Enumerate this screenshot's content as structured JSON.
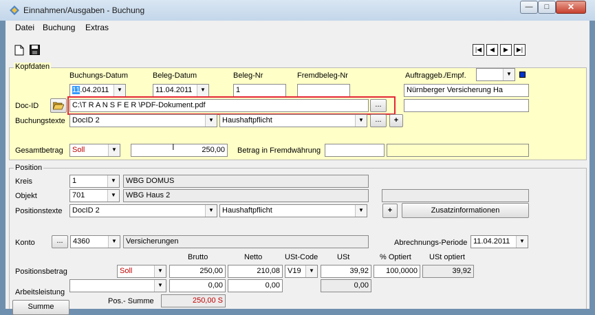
{
  "window": {
    "title": "Einnahmen/Ausgaben - Buchung",
    "close_glyph": "✕",
    "min_glyph": "—",
    "max_glyph": "□"
  },
  "menu": [
    "Datei",
    "Buchung",
    "Extras"
  ],
  "toolbar": {
    "icons": [
      "new-document-icon",
      "save-icon"
    ],
    "nav": [
      "|◀",
      "◀",
      "▶",
      "▶|"
    ]
  },
  "kopfdaten": {
    "legend": "Kopfdaten",
    "buchungsdatum": {
      "label": "Buchungs-Datum",
      "day": "11",
      "rest": ".04.2011"
    },
    "belegdatum": {
      "label": "Beleg-Datum",
      "value": "11.04.2011"
    },
    "belegnr": {
      "label": "Beleg-Nr",
      "value": "1"
    },
    "fremdbelegnr": {
      "label": "Fremdbeleg-Nr",
      "value": ""
    },
    "auftraggeber": {
      "label": "Auftraggeb./Empf.",
      "combo": "",
      "value": "Nürnberger Versicherung Ha",
      "extra": ""
    },
    "docid": {
      "label": "Doc-ID",
      "value": "C:\\T R A N S F E R \\PDF-Dokument.pdf",
      "browse": "..."
    },
    "buchungstexte": {
      "label": "Buchungstexte",
      "combo1": "DocID 2",
      "combo2": "Haushaftpflicht",
      "dots": "...",
      "plus": "+"
    },
    "gesamtbetrag": {
      "label": "Gesamtbetrag",
      "soll": "Soll",
      "value": "250,00"
    },
    "fremdwaehrung": {
      "label": "Betrag in Fremdwährung",
      "value": "",
      "extra": ""
    }
  },
  "position": {
    "legend": "Position",
    "kreis": {
      "label": "Kreis",
      "code": "1",
      "name": "WBG DOMUS"
    },
    "objekt": {
      "label": "Objekt",
      "code": "701",
      "name": "WBG Haus 2",
      "extra": ""
    },
    "positionstexte": {
      "label": "Positionstexte",
      "combo1": "DocID 2",
      "combo2": "Haushaftpflicht",
      "plus": "+",
      "zusatz": "Zusatzinformationen"
    },
    "konto": {
      "label": "Konto",
      "dots": "...",
      "code": "4360",
      "name": "Versicherungen"
    },
    "abrechnung": {
      "label": "Abrechnungs-Periode",
      "value": "11.04.2011"
    },
    "columns": {
      "brutto": "Brutto",
      "netto": "Netto",
      "ustcode": "USt-Code",
      "ust": "USt",
      "optiert": "% Optiert",
      "ustoptiert": "USt optiert"
    },
    "positionsbetrag": {
      "label": "Positionsbetrag",
      "soll": "Soll",
      "brutto": "250,00",
      "netto": "210,08",
      "ustcode": "V19",
      "ust": "39,92",
      "optiert": "100,0000",
      "ustoptiert": "39,92"
    },
    "arbeitsleistung": {
      "label": "Arbeitsleistung",
      "combo": "",
      "brutto": "0,00",
      "netto": "0,00",
      "ust": "0,00"
    },
    "summe_button": "Summe",
    "possumme": {
      "label": "Pos.- Summe",
      "value": "250,00 S"
    }
  },
  "colors": {
    "highlight": "#e32636",
    "yellow_panel": "#ffffc8",
    "soll_red": "#c00000"
  }
}
